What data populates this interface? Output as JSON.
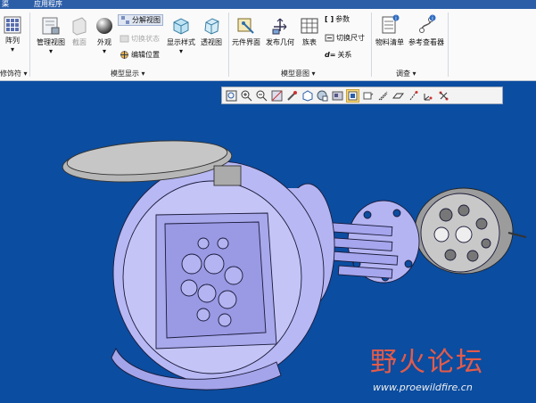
{
  "menu": {
    "item1": "渠",
    "item2": "应用程序"
  },
  "ribbon": {
    "array_label": "阵列",
    "modifiers_label": "修饰符 ▾",
    "manage_views_label": "管理视图",
    "section_label": "截面",
    "appearance_label": "外观",
    "exploded_view_label": "分解视图",
    "toggle_status_label": "切换状态",
    "edit_position_label": "编辑位置",
    "display_style_label": "显示样式",
    "perspective_label": "透视图",
    "model_display_group": "模型显示 ▾",
    "component_interface_label": "元件界面",
    "publish_geometry_label": "发布几何",
    "table_label": "族表",
    "parameters_label": "参数",
    "switch_dimensions_label": "切换尺寸",
    "relations_label": "关系",
    "model_intent_group": "模型意图 ▾",
    "bom_label": "物料清单",
    "reference_viewer_label": "参考查看器",
    "investigate_group": "调查 ▾"
  },
  "view_toolbar": {
    "icons": [
      "zoom-fit-icon",
      "zoom-in-icon",
      "zoom-out-icon",
      "repaint-icon",
      "spin-center-icon",
      "saved-orientations-icon",
      "saved-views-icon",
      "display-style-icon",
      "section-toggle-icon",
      "datum-display-icon",
      "datum-axes-icon",
      "datum-planes-icon",
      "datum-points-icon",
      "csys-icon",
      "annotations-icon"
    ],
    "active_index": 8
  },
  "watermark": {
    "cn": "野火论坛",
    "url": "www.proewildfire.cn"
  },
  "colors": {
    "viewport_bg": "#0b4da0",
    "model_fill": "#b4b4f2",
    "model_edge": "#1a1a3a"
  }
}
